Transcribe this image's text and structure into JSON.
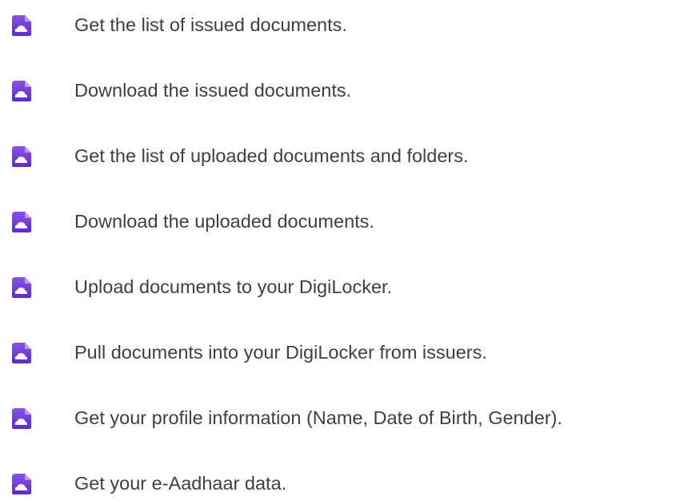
{
  "permissions": {
    "items": [
      {
        "label": "Get the list of issued documents.",
        "icon": "cloud-document-icon"
      },
      {
        "label": "Download the issued documents.",
        "icon": "cloud-document-icon"
      },
      {
        "label": "Get the list of uploaded documents and folders.",
        "icon": "cloud-document-icon"
      },
      {
        "label": "Download the uploaded documents.",
        "icon": "cloud-document-icon"
      },
      {
        "label": "Upload documents to your DigiLocker.",
        "icon": "cloud-document-icon"
      },
      {
        "label": "Pull documents into your DigiLocker from issuers.",
        "icon": "cloud-document-icon"
      },
      {
        "label": "Get your profile information (Name, Date of Birth, Gender).",
        "icon": "cloud-document-icon"
      },
      {
        "label": "Get your e-Aadhaar data.",
        "icon": "cloud-document-icon"
      }
    ]
  },
  "colors": {
    "icon_top": "#8a52e8",
    "icon_bottom": "#5d2ad0",
    "text": "#3f3f3f"
  }
}
